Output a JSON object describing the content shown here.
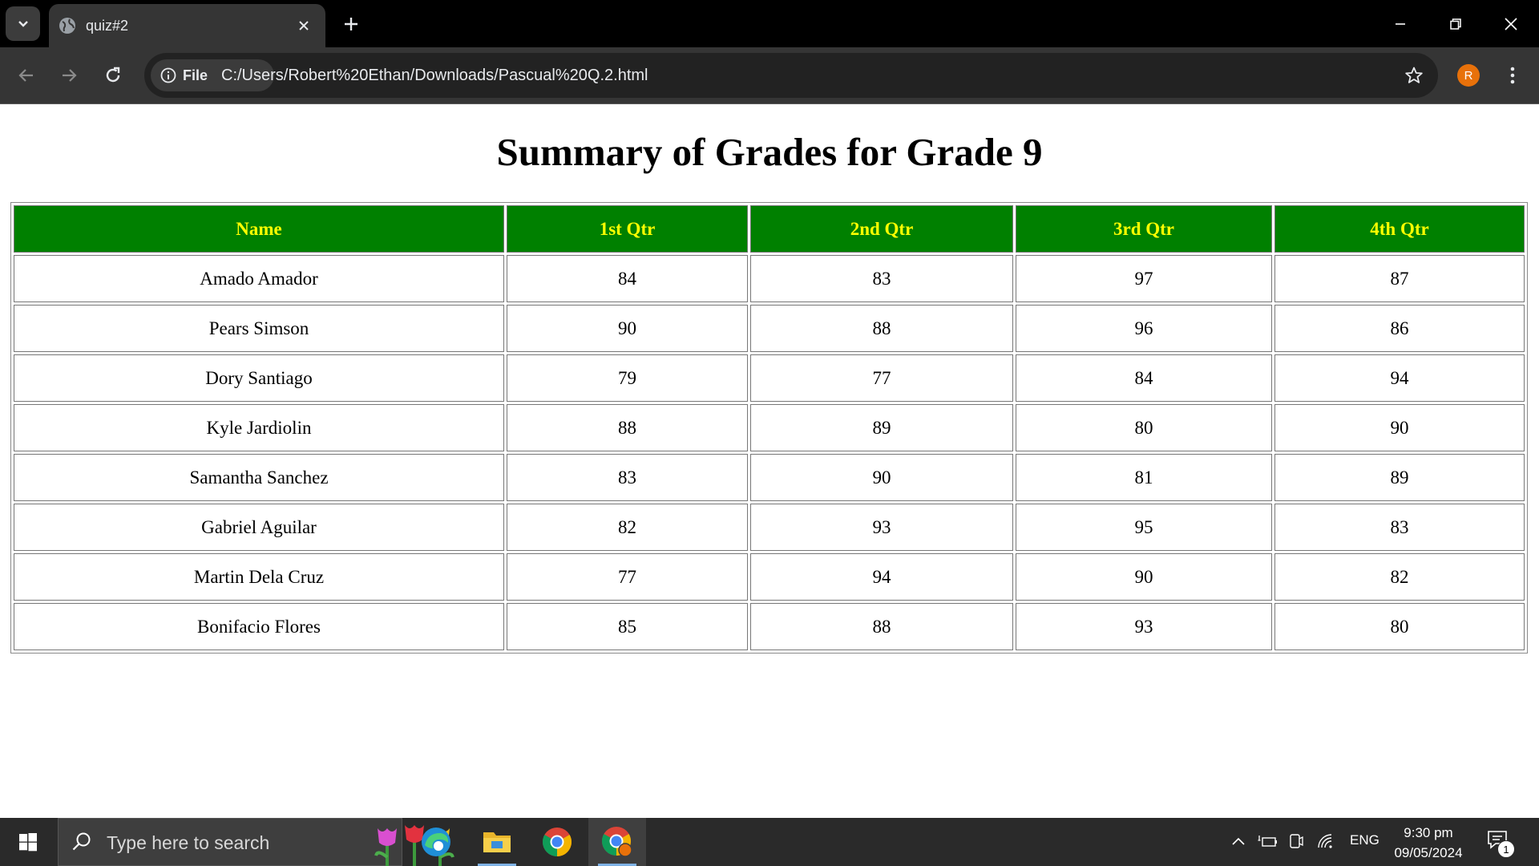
{
  "browser": {
    "tab_title": "quiz#2",
    "file_chip_label": "File",
    "url": "C:/Users/Robert%20Ethan/Downloads/Pascual%20Q.2.html",
    "profile_initial": "R"
  },
  "page": {
    "heading": "Summary of Grades for Grade 9",
    "table": {
      "headers": [
        "Name",
        "1st Qtr",
        "2nd Qtr",
        "3rd Qtr",
        "4th Qtr"
      ],
      "rows": [
        [
          "Amado Amador",
          "84",
          "83",
          "97",
          "87"
        ],
        [
          "Pears Simson",
          "90",
          "88",
          "96",
          "86"
        ],
        [
          "Dory Santiago",
          "79",
          "77",
          "84",
          "94"
        ],
        [
          "Kyle Jardiolin",
          "88",
          "89",
          "80",
          "90"
        ],
        [
          "Samantha Sanchez",
          "83",
          "90",
          "81",
          "89"
        ],
        [
          "Gabriel Aguilar",
          "82",
          "93",
          "95",
          "83"
        ],
        [
          "Martin Dela Cruz",
          "77",
          "94",
          "90",
          "82"
        ],
        [
          "Bonifacio Flores",
          "85",
          "88",
          "93",
          "80"
        ]
      ],
      "header_bg": "#008000",
      "header_fg": "#ffff00"
    }
  },
  "taskbar": {
    "search_placeholder": "Type here to search",
    "language": "ENG",
    "time": "9:30 pm",
    "date": "09/05/2024",
    "notification_count": "1",
    "pinned_apps": [
      "edge-icon",
      "file-explorer-icon",
      "chrome-icon",
      "chrome-profile-icon"
    ]
  }
}
